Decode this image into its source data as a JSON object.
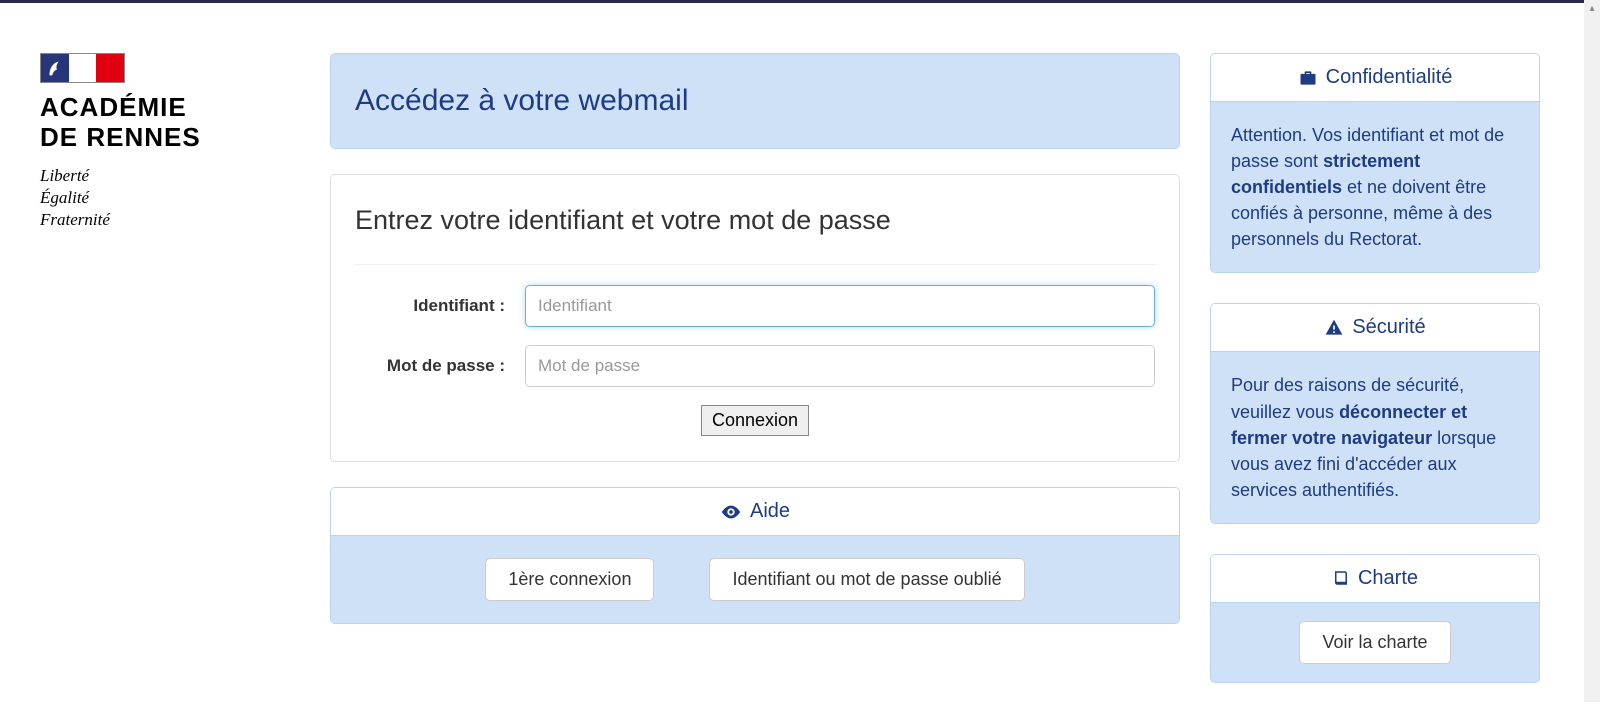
{
  "logo": {
    "line1": "ACADÉMIE",
    "line2": "DE RENNES",
    "motto1": "Liberté",
    "motto2": "Égalité",
    "motto3": "Fraternité"
  },
  "main": {
    "title": "Accédez à votre webmail",
    "form": {
      "heading": "Entrez votre identifiant et votre mot de passe",
      "id_label": "Identifiant :",
      "id_placeholder": "Identifiant",
      "pw_label": "Mot de passe :",
      "pw_placeholder": "Mot de passe",
      "submit": "Connexion"
    },
    "help": {
      "title": "Aide",
      "first_login": "1ère connexion",
      "forgot": "Identifiant ou mot de passe oublié"
    }
  },
  "side": {
    "confid": {
      "title": "Confidentialité",
      "text_pre": "Attention. Vos identifiant et mot de passe sont ",
      "text_bold": "strictement confidentiels",
      "text_post": " et ne doivent être confiés à personne, même à des personnels du Rectorat."
    },
    "secu": {
      "title": "Sécurité",
      "text_pre": "Pour des raisons de sécurité, veuillez vous ",
      "text_bold": "déconnecter et fermer votre navigateur",
      "text_post": " lorsque vous avez fini d'accéder aux services authentifiés."
    },
    "charte": {
      "title": "Charte",
      "button": "Voir la charte"
    }
  }
}
